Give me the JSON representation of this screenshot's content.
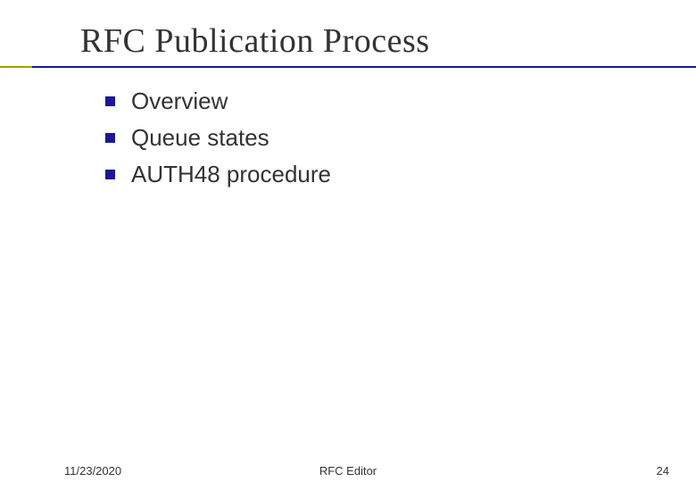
{
  "slide": {
    "title": "RFC Publication Process",
    "bullets": [
      "Overview",
      "Queue states",
      "AUTH48 procedure"
    ]
  },
  "footer": {
    "date": "11/23/2020",
    "center": "RFC Editor",
    "page": "24"
  }
}
